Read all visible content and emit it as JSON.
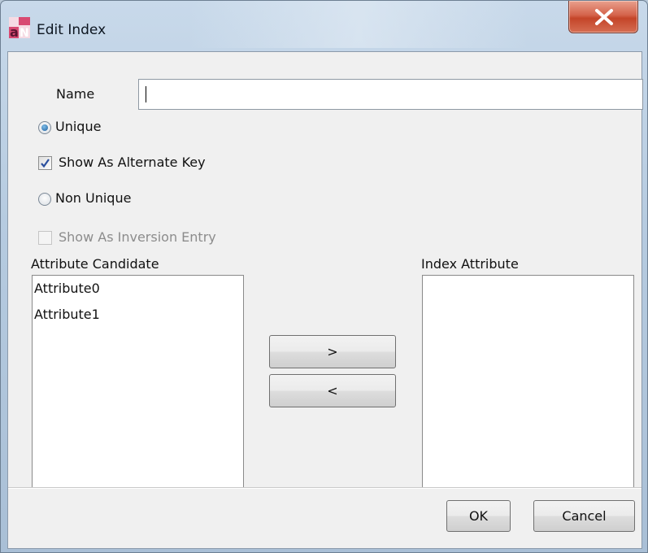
{
  "window": {
    "title": "Edit Index",
    "app_icon": "app-logo-icon",
    "close_icon": "close-icon"
  },
  "form": {
    "name_label": "Name",
    "name_value": "",
    "unique_label": "Unique",
    "unique_selected": true,
    "show_alternate_key_label": "Show As Alternate Key",
    "show_alternate_key_checked": true,
    "non_unique_label": "Non Unique",
    "non_unique_selected": false,
    "show_inversion_entry_label": "Show As Inversion Entry",
    "show_inversion_entry_checked": false,
    "show_inversion_entry_enabled": false
  },
  "lists": {
    "candidate_header": "Attribute Candidate",
    "candidate_items": [
      "Attribute0",
      "Attribute1"
    ],
    "index_header": "Index Attribute",
    "index_items": []
  },
  "buttons": {
    "add": ">",
    "remove": "<",
    "ok": "OK",
    "cancel": "Cancel"
  },
  "colors": {
    "close_button": "#c44529",
    "dialog_background": "#f0f0f0",
    "checkmark": "#2a4f9e",
    "radio_dot": "#1c5f9e"
  }
}
